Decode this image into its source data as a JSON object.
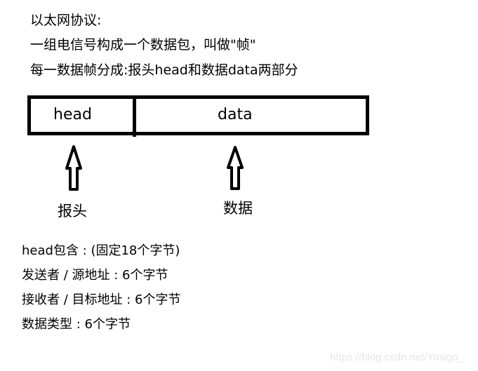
{
  "intro": {
    "lines": [
      "以太网协议:",
      "一组电信号构成一个数据包，叫做\"帧\"",
      "每一数据帧分成:报头head和数据data两部分"
    ]
  },
  "frame": {
    "cells": [
      {
        "label": "head"
      },
      {
        "label": "data"
      }
    ]
  },
  "callouts": {
    "head": "报头",
    "data": "数据"
  },
  "details": {
    "lines": [
      "head包含 : (固定18个字节)",
      "发送者 / 源地址 : 6个字节",
      "接收者 / 目标地址 : 6个字节",
      "数据类型 : 6个字节"
    ]
  },
  "watermark": "https://blog.csdn.net/Yosigo_"
}
